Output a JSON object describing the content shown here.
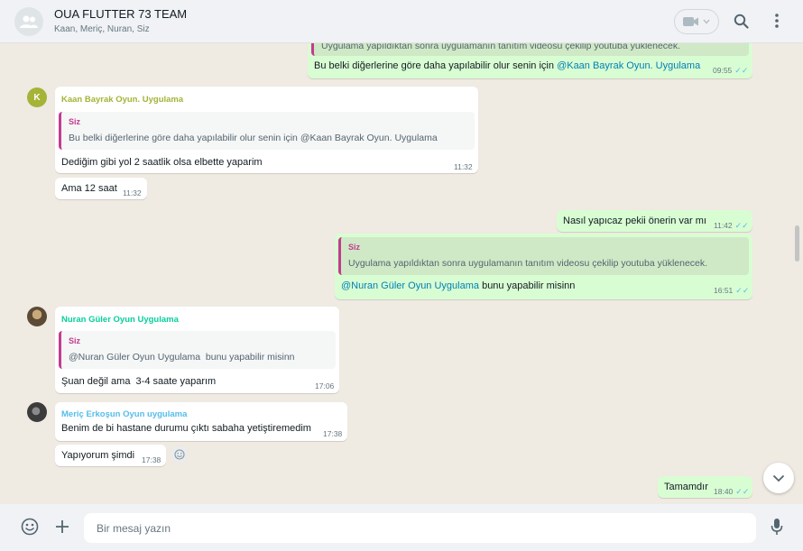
{
  "header": {
    "title": "OUA FLUTTER 73 TEAM",
    "subtitle": "Kaan, Meriç, Nuran, Siz"
  },
  "messages": {
    "m0": {
      "quote_text": "Uygulama yapıldıktan sonra uygulamanın tanıtım videosu çekilip youtuba yüklenecek.",
      "text": "Bu belki diğerlerine göre daha yapılabilir olur senin için",
      "mention": "@Kaan Bayrak Oyun. Uygulama",
      "time": "09:55"
    },
    "m1": {
      "avatar_letter": "K",
      "sender": "Kaan Bayrak Oyun. Uygulama",
      "quote_name": "Siz",
      "quote_text": "Bu belki diğerlerine göre daha yapılabilir olur senin için @Kaan Bayrak Oyun. Uygulama",
      "text": "Dediğim gibi yol 2 saatlik olsa elbette yaparim",
      "time": "11:32"
    },
    "m2": {
      "text": "Ama 12 saat",
      "time": "11:32"
    },
    "m3": {
      "text": "Nasıl yapıcaz pekii önerin var mı",
      "time": "11:42"
    },
    "m4": {
      "quote_name": "Siz",
      "quote_text": "Uygulama yapıldıktan sonra uygulamanın tanıtım videosu çekilip youtuba yüklenecek.",
      "mention": "@Nuran Güler Oyun Uygulama",
      "text": " bunu yapabilir misinn",
      "time": "16:51"
    },
    "m5": {
      "sender": "Nuran Güler Oyun Uygulama",
      "quote_name": "Siz",
      "quote_text": "@Nuran Güler Oyun Uygulama  bunu yapabilir misinn",
      "text": "Şuan değil ama  3-4 saate yaparım",
      "time": "17:06"
    },
    "m6": {
      "sender": "Meriç Erkoşun Oyun uygulama",
      "text": "Benim de bi hastane durumu çıktı sabaha yetiştiremedim",
      "time": "17:38"
    },
    "m7": {
      "text": "Yapıyorum şimdi",
      "time": "17:38"
    },
    "m8": {
      "text": "Tamamdır",
      "time": "18:40"
    }
  },
  "composer": {
    "placeholder": "Bir mesaj yazın"
  },
  "colors": {
    "header_bg": "#f0f2f5",
    "chat_bg": "#efeae2",
    "outgoing_bubble": "#d9fdd3",
    "incoming_bubble": "#ffffff",
    "quote_bar": "#c33b8f",
    "mention": "#027eb5",
    "read_ticks": "#53bdeb",
    "kaan_name": "#a5b337",
    "nuran_name": "#06cf9c",
    "meric_name": "#53bdeb"
  },
  "icons": {
    "group_avatar": "group-icon",
    "video": "video-camera-icon",
    "search": "search-icon",
    "menu": "more-vertical-icon",
    "scroll_down": "chevron-down-icon",
    "emoji": "emoji-icon",
    "attach": "plus-icon",
    "mic": "microphone-icon",
    "ticks": "double-check-icon"
  }
}
